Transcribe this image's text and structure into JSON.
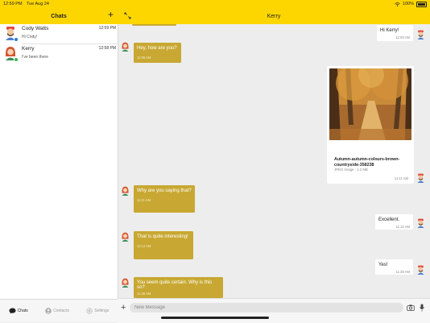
{
  "status_bar": {
    "time": "12:59 PM",
    "date": "Tue Aug 24",
    "battery": "100%"
  },
  "sidebar": {
    "title": "Chats",
    "chats": [
      {
        "name": "Cody Watts",
        "time": "12:59 PM",
        "preview": "Hi Cody!",
        "status_color": "#2a7bd8"
      },
      {
        "name": "Kerry",
        "time": "12:58 PM",
        "preview": "I've been there",
        "status_color": "#3cb54a"
      }
    ]
  },
  "tabs": [
    {
      "label": "Chats",
      "icon": "chat-bubble-icon",
      "active": true
    },
    {
      "label": "Contacts",
      "icon": "person-icon",
      "active": false
    },
    {
      "label": "Settings",
      "icon": "gear-icon",
      "active": false
    }
  ],
  "conversation": {
    "title": "Kerry",
    "messages": [
      {
        "text": "Hi Kerry!",
        "time": "11:00 AM",
        "dir": "out"
      },
      {
        "text": "Hey, how are you?",
        "time": "11:05 AM",
        "dir": "in"
      },
      {
        "type": "image",
        "file_name": "Autumn-autumn-colours-brown-countryside-358238",
        "file_size": "JPEG Image · 1.2 MB",
        "time": "11:11 AM",
        "dir": "out"
      },
      {
        "text": "Why are you saying that?",
        "time": "11:11 AM",
        "dir": "in"
      },
      {
        "text": "Excellent.",
        "time": "11:12 AM",
        "dir": "out"
      },
      {
        "text": "That is quite interesting!",
        "time": "11:12 AM",
        "dir": "in"
      },
      {
        "text": "Yes!",
        "time": "11:38 AM",
        "dir": "out"
      },
      {
        "text": "You seem quite certain. Why is this so?",
        "time": "11:38 AM",
        "dir": "in"
      }
    ]
  },
  "composer": {
    "placeholder": "New Message"
  },
  "colors": {
    "accent": "#fdd600",
    "incoming_bubble": "#c8a832",
    "outgoing_bubble": "#ffffff"
  }
}
